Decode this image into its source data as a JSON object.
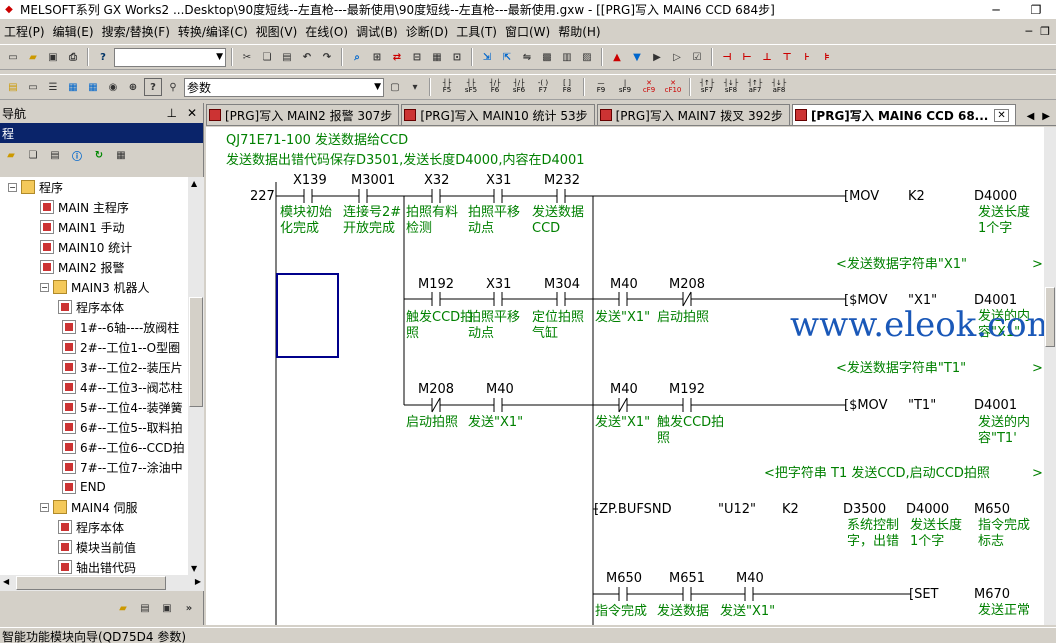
{
  "window": {
    "title": "MELSOFT系列 GX Works2 ...Desktop\\90度短线--左直枪---最新使用\\90度短线--左直枪---最新使用.gxw - [[PRG]写入 MAIN6 CCD 684步]"
  },
  "menu": [
    "工程(P)",
    "编辑(E)",
    "搜索/替换(F)",
    "转换/编译(C)",
    "视图(V)",
    "在线(O)",
    "调试(B)",
    "诊断(D)",
    "工具(T)",
    "窗口(W)",
    "帮助(H)"
  ],
  "toolbar": {
    "param_combo": "参数",
    "sf_keys": [
      "F5",
      "sF5",
      "F6",
      "sF6",
      "F7",
      "F8",
      "F9",
      "sF9",
      "cF9",
      "cF10",
      "sF7",
      "sF8",
      "aF7",
      "aF8"
    ],
    "f_keys": [
      "F9",
      "sF9",
      "cF9",
      "cF10"
    ]
  },
  "nav": {
    "title": "导航",
    "subtitle": "程",
    "tree": [
      {
        "label": "程序",
        "depth": 0,
        "icon": "folder"
      },
      {
        "label": "MAIN 主程序",
        "depth": 1,
        "icon": "prg"
      },
      {
        "label": "MAIN1 手动",
        "depth": 1,
        "icon": "prg"
      },
      {
        "label": "MAIN10 统计",
        "depth": 1,
        "icon": "prg"
      },
      {
        "label": "MAIN2 报警",
        "depth": 1,
        "icon": "prg"
      },
      {
        "label": "MAIN3 机器人",
        "depth": 1,
        "icon": "folder"
      },
      {
        "label": "程序本体",
        "depth": 2,
        "icon": "prg"
      },
      {
        "label": "1#--6轴----放阀柱",
        "depth": 3,
        "icon": "prg"
      },
      {
        "label": "2#--工位1--O型圈",
        "depth": 3,
        "icon": "prg"
      },
      {
        "label": "3#--工位2--装压片",
        "depth": 3,
        "icon": "prg"
      },
      {
        "label": "4#--工位3--阀芯柱",
        "depth": 3,
        "icon": "prg"
      },
      {
        "label": "5#--工位4--装弹簧",
        "depth": 3,
        "icon": "prg"
      },
      {
        "label": "6#--工位5--取料拍",
        "depth": 3,
        "icon": "prg"
      },
      {
        "label": "6#--工位6--CCD拍",
        "depth": 3,
        "icon": "prg"
      },
      {
        "label": "7#--工位7--涂油中",
        "depth": 3,
        "icon": "prg"
      },
      {
        "label": "END",
        "depth": 3,
        "icon": "prg"
      },
      {
        "label": "MAIN4 伺服",
        "depth": 1,
        "icon": "folder"
      },
      {
        "label": "程序本体",
        "depth": 2,
        "icon": "prg"
      },
      {
        "label": "模块当前值",
        "depth": 2,
        "icon": "prg"
      },
      {
        "label": "轴出错代码",
        "depth": 2,
        "icon": "prg"
      }
    ]
  },
  "tabs": [
    {
      "label": "[PRG]写入 MAIN2 报警 307步",
      "active": false
    },
    {
      "label": "[PRG]写入 MAIN10 统计 53步",
      "active": false
    },
    {
      "label": "[PRG]写入 MAIN7 拨叉 392步",
      "active": false
    },
    {
      "label": "[PRG]写入 MAIN6 CCD 68...",
      "active": true
    }
  ],
  "ladder": {
    "header1": "QJ71E71-100 发送数据给CCD",
    "header2": "发送数据出错代码保存D3501,发送长度D4000,内容在D4001",
    "step": "227",
    "row1": {
      "contacts": [
        "X139",
        "M3001",
        "X32",
        "X31",
        "M232"
      ],
      "c1": [
        "模块初始",
        "化完成"
      ],
      "c2": [
        "连接号2#",
        "开放完成"
      ],
      "c3": [
        "拍照有料",
        "检测"
      ],
      "c4": [
        "拍照平移",
        "动点"
      ],
      "c5": [
        "发送数据",
        "CCD"
      ],
      "instr": "[MOV",
      "op1": "K2",
      "op2": "D4000",
      "cmt": [
        "发送长度",
        "1个字"
      ]
    },
    "note1": "<发送数据字符串\"X1\"",
    "row2": {
      "contacts": [
        "M192",
        "X31",
        "M304",
        "M40",
        "M208"
      ],
      "c1": [
        "触发CCD拍",
        "照"
      ],
      "c2": [
        "拍照平移",
        "动点"
      ],
      "c3": [
        "定位拍照",
        "气缸"
      ],
      "c4": "发送\"X1\"",
      "c5": "启动拍照",
      "instr": "[$MOV",
      "op1": "\"X1\"",
      "op2": "D4001",
      "cmt": [
        "发送的内",
        "容\"X1\""
      ]
    },
    "note2": "<发送数据字符串\"T1\"",
    "row3": {
      "contacts": [
        "M208",
        "M40",
        "M40",
        "M192"
      ],
      "c1": "启动拍照",
      "c2": "发送\"X1\"",
      "c3": "发送\"X1\"",
      "c4": [
        "触发CCD拍",
        "照"
      ],
      "instr": "[$MOV",
      "op1": "\"T1\"",
      "op2": "D4001",
      "cmt": [
        "发送的内",
        "容\"T1'"
      ]
    },
    "note3": "<把字符串 T1 发送CCD,启动CCD拍照",
    "row4": {
      "instr": "[ZP.BUFSND",
      "op1": "\"U12\"",
      "op2": "K2",
      "op3": "D3500",
      "op4": "D4000",
      "op5": "M650",
      "cmt3": [
        "系统控制",
        "字，出错"
      ],
      "cmt4": [
        "发送长度",
        "1个字"
      ],
      "cmt5": [
        "指令完成",
        "标志"
      ]
    },
    "row5": {
      "contacts": [
        "M650",
        "M651",
        "M40"
      ],
      "c1": "指令完成",
      "c2": "发送数据",
      "c3": "发送\"X1\"",
      "instr": "[SET",
      "op1": "M670",
      "cmt": "发送正常"
    }
  },
  "watermark": "www.eleok.com",
  "status": "智能功能模块向导(QD75D4 参数)"
}
